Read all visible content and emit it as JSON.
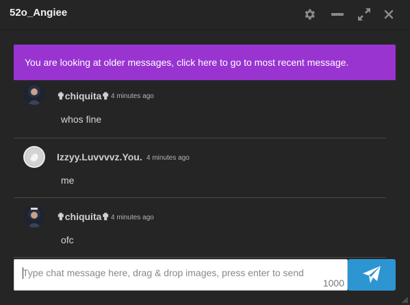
{
  "window": {
    "title": "52o_Angiee",
    "icons": [
      "gear-icon",
      "minimize-icon",
      "expand-icon",
      "close-icon"
    ]
  },
  "banner": {
    "text": "You are looking at older messages, click here to go to most recent message."
  },
  "messages": [
    {
      "username": "✟chiquita✟",
      "time": "4 minutes ago",
      "text": "whos fine"
    },
    {
      "username": "Izzyy.Luvvvvz.You.",
      "time": "4 minutes ago",
      "text": "me"
    },
    {
      "username": "✟chiquita✟",
      "time": "4 minutes ago",
      "text": "ofc"
    }
  ],
  "composer": {
    "placeholder": "Type chat message here, drag & drop images, press enter to send",
    "char_limit": "1000"
  },
  "colors": {
    "background": "#252525",
    "banner": "#9934d1",
    "send_button": "#2e95d3"
  }
}
